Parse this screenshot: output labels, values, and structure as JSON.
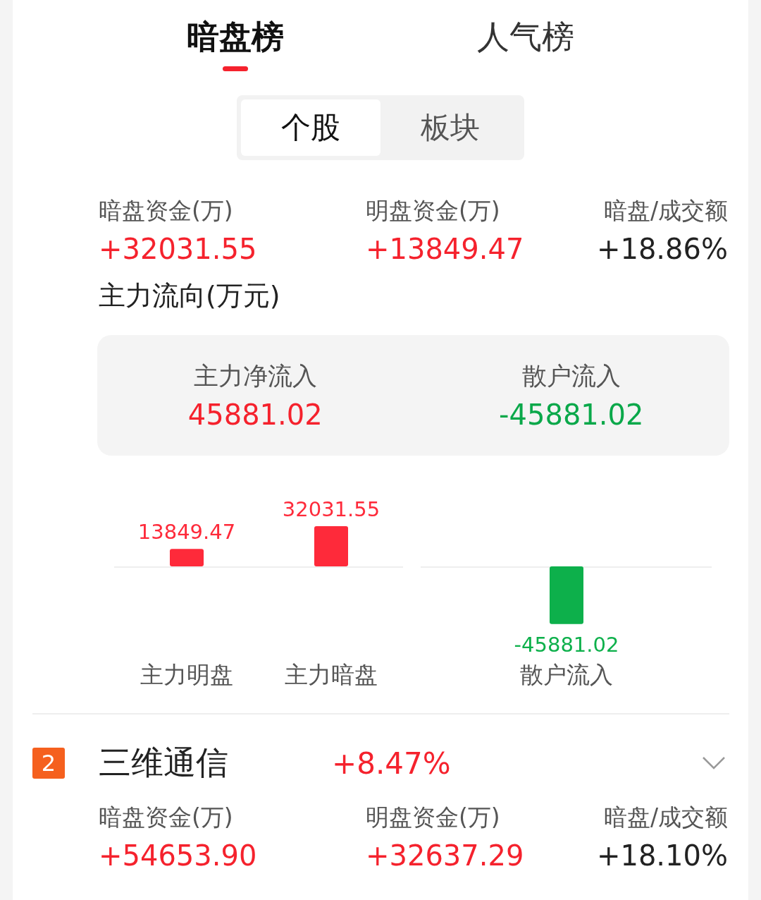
{
  "top_tabs": [
    {
      "label": "暗盘榜",
      "selected": true
    },
    {
      "label": "人气榜",
      "selected": false
    }
  ],
  "segment": [
    {
      "label": "个股",
      "selected": true
    },
    {
      "label": "板块",
      "selected": false
    }
  ],
  "summary": {
    "stats": [
      {
        "label": "暗盘资金(万)",
        "value": "+32031.55",
        "kind": "up"
      },
      {
        "label": "明盘资金(万)",
        "value": "+13849.47",
        "kind": "up"
      },
      {
        "label": "暗盘/成交额",
        "value": "+18.86%",
        "kind": "plain"
      }
    ]
  },
  "flow": {
    "title": "主力流向(万元)",
    "items": [
      {
        "label": "主力净流入",
        "value": "45881.02",
        "kind": "up"
      },
      {
        "label": "散户流入",
        "value": "-45881.02",
        "kind": "down"
      }
    ],
    "chart_data": {
      "type": "bar",
      "categories": [
        "主力明盘",
        "主力暗盘",
        "散户流入"
      ],
      "values": [
        13849.47,
        32031.55,
        -45881.02
      ],
      "value_labels": [
        "13849.47",
        "32031.55",
        "-45881.02"
      ],
      "data_labels": true
    }
  },
  "stocks": [
    {
      "rank": "2",
      "name": "三维通信",
      "change": "+8.47%",
      "expanded": false,
      "stats": [
        {
          "label": "暗盘资金(万)",
          "value": "+54653.90",
          "kind": "up"
        },
        {
          "label": "明盘资金(万)",
          "value": "+32637.29",
          "kind": "up"
        },
        {
          "label": "暗盘/成交额",
          "value": "+18.10%",
          "kind": "plain"
        }
      ]
    }
  ]
}
